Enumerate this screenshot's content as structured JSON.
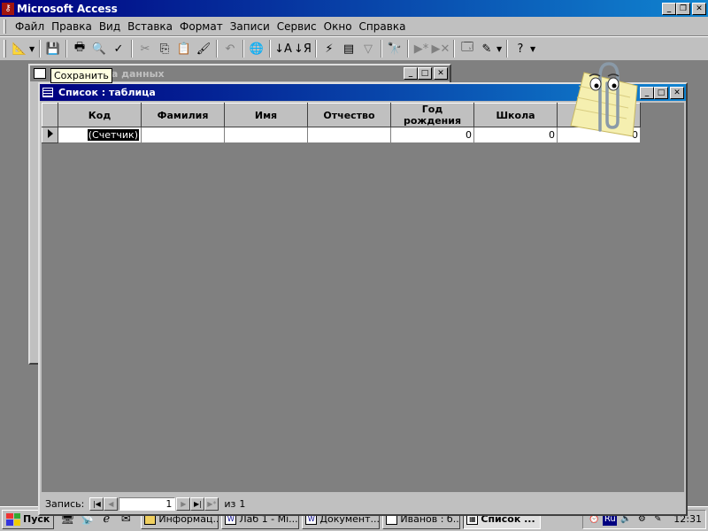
{
  "app": {
    "title": "Microsoft Access"
  },
  "menu": [
    "Файл",
    "Правка",
    "Вид",
    "Вставка",
    "Формат",
    "Записи",
    "Сервис",
    "Окно",
    "Справка"
  ],
  "tooltip": "Сохранить",
  "db_window": {
    "caption": "аза данных"
  },
  "table_window": {
    "title": "Список : таблица",
    "columns": [
      "Код",
      "Фамилия",
      "Имя",
      "Отчество",
      "Год рождения",
      "Школа",
      "К"
    ],
    "new_row": [
      "(Счетчик)",
      "",
      "",
      "",
      "0",
      "0",
      "0"
    ]
  },
  "navigation": {
    "label": "Запись:",
    "current": "1",
    "of_label": "из",
    "total": "1"
  },
  "taskbar": {
    "start": "Пуск",
    "tasks": [
      "Информац...",
      "Лаб 1 - Mi...",
      "Документ...",
      "Иванов : б...",
      "Список ..."
    ],
    "lang": "Ru",
    "clock": "12:31"
  }
}
